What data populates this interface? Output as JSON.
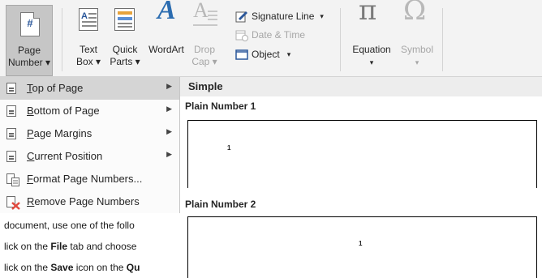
{
  "ribbon": {
    "page_number": {
      "line1": "Page",
      "line2": "Number ▾",
      "icon_char": "#"
    },
    "text_box": {
      "line1": "Text",
      "line2": "Box ▾"
    },
    "quick_parts": {
      "line1": "Quick",
      "line2": "Parts ▾"
    },
    "wordart": {
      "line1": "WordArt",
      "glyph": "A"
    },
    "drop_cap": {
      "line1": "Drop",
      "line2": "Cap ▾",
      "glyph": "A"
    },
    "signature_line": "Signature Line",
    "signature_dropdown": "▾",
    "date_time": "Date & Time",
    "object": "Object",
    "object_dropdown": "▾",
    "equation": {
      "label": "Equation",
      "glyph": "π",
      "dropdown": "▾"
    },
    "symbol": {
      "label": "Symbol",
      "glyph": "Ω",
      "dropdown": "▾"
    }
  },
  "menu": {
    "items": [
      {
        "label_u": "T",
        "label_rest": "op of Page",
        "has_arrow": true,
        "active": true
      },
      {
        "label_u": "B",
        "label_rest": "ottom of Page",
        "has_arrow": true,
        "active": false
      },
      {
        "label_u": "P",
        "label_rest": "age Margins",
        "has_arrow": true,
        "active": false
      },
      {
        "label_u": "C",
        "label_rest": "urrent Position",
        "has_arrow": true,
        "active": false
      },
      {
        "label_u": "F",
        "label_rest": "ormat Page Numbers...",
        "has_arrow": false,
        "active": false
      },
      {
        "label_u": "R",
        "label_rest": "emove Page Numbers",
        "has_arrow": false,
        "active": false
      }
    ],
    "arrow_glyph": "▶"
  },
  "gallery": {
    "header": "Simple",
    "section1": "Plain Number 1",
    "section2": "Plain Number 2",
    "num_glyph": "1"
  },
  "document": {
    "line1": "document, use one of the follo",
    "line2_pre": "lick on the ",
    "line2_bold": "File",
    "line2_post": " tab and choose",
    "line3_pre": "lick on the ",
    "line3_bold": "Save",
    "line3_post": " icon on the ",
    "line3_bold2": "Qu"
  },
  "colors": {
    "ribbon_bg": "#f3f3f3",
    "selected_btn": "#c6c6c6",
    "menu_active": "#d5d5d5",
    "accent_blue": "#2b579a",
    "remove_red": "#e04a3f"
  }
}
